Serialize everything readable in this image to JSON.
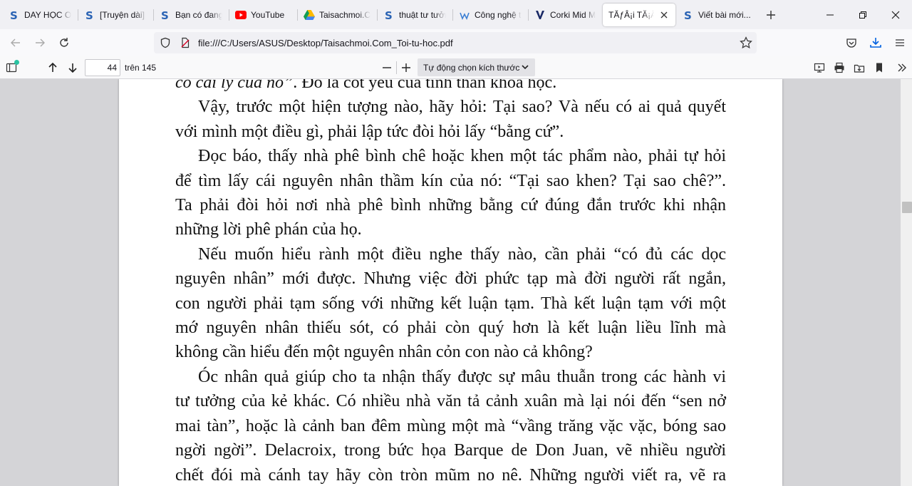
{
  "tabs": [
    {
      "title": "DAY HỌC ON",
      "icon": "s-icon",
      "fade": true
    },
    {
      "title": "[Truyện dài] N",
      "icon": "s-icon",
      "fade": true
    },
    {
      "title": "Bạn có đang",
      "icon": "s-icon",
      "fade": true
    },
    {
      "title": "YouTube",
      "icon": "youtube-icon",
      "fade": false
    },
    {
      "title": "Taisachmoi.C",
      "icon": "google-drive-icon",
      "fade": true
    },
    {
      "title": "thuật tư tưởn",
      "icon": "s-icon",
      "fade": true
    },
    {
      "title": "Công nghệ th",
      "icon": "wp-icon",
      "fade": true
    },
    {
      "title": "Corki Mid Mù",
      "icon": "v-icon",
      "fade": true
    },
    {
      "title": "TĂƒÂ¡i TĂ¡Â»Â",
      "icon": "none",
      "fade": true,
      "active": true
    },
    {
      "title": "Viết bài mới...",
      "icon": "s-icon",
      "fade": false
    }
  ],
  "navbar": {
    "url": "file:///C:/Users/ASUS/Desktop/Taisachmoi.Com_Toi-tu-hoc.pdf"
  },
  "pdf_toolbar": {
    "page_number": "44",
    "page_count": "trên 145",
    "zoom_label": "Tự động chọn kích thước"
  },
  "document": {
    "lines": [
      {
        "t": "có cái lý của nó”. Đó là cốt yếu của tinh thần khoa học.",
        "italic_prefix": "có cái lý của nó”",
        "indent": false,
        "last": true
      },
      {
        "t": "Vậy, trước một hiện tượng nào, hãy hỏi: Tại sao? Và nếu có ai quả quyết",
        "indent": true,
        "last": false
      },
      {
        "t": "với mình một điều gì, phải lập tức đòi hỏi lấy “bằng cứ”.",
        "indent": false,
        "last": true
      },
      {
        "t": "Đọc báo, thấy nhà phê bình chê hoặc khen một tác phẩm nào, phải tự hỏi",
        "indent": true,
        "last": false
      },
      {
        "t": "để tìm lấy cái nguyên nhân thầm kín của nó: “Tại sao khen? Tại sao chê?”.",
        "indent": false,
        "last": false
      },
      {
        "t": "Ta phải đòi hỏi nơi nhà phê bình những bằng cứ đúng đắn trước khi nhận",
        "indent": false,
        "last": false
      },
      {
        "t": "những lời phê phán của họ.",
        "indent": false,
        "last": true
      },
      {
        "t": "Nếu muốn hiểu rành một điều nghe thấy nào, cần phải “có đủ các dọc",
        "indent": true,
        "last": false
      },
      {
        "t": "nguyên nhân” mới được. Nhưng việc đời phức tạp mà đời người rất ngắn,",
        "indent": false,
        "last": false
      },
      {
        "t": "con người phải tạm sống với những kết luận tạm. Thà kết luận tạm với một",
        "indent": false,
        "last": false
      },
      {
        "t": "mớ nguyên nhân thiếu sót, có phải còn quý hơn là kết luận liều lĩnh mà",
        "indent": false,
        "last": false
      },
      {
        "t": "không cần hiểu đến một nguyên nhân cỏn con nào cả không?",
        "indent": false,
        "last": true
      },
      {
        "t": "Óc nhân quả giúp cho ta nhận thấy được sự mâu thuẫn trong các hành vi",
        "indent": true,
        "last": false
      },
      {
        "t": "tư tưởng của kẻ khác. Có nhiều nhà văn tả cảnh xuân mà lại nói đến “sen nở",
        "indent": false,
        "last": false
      },
      {
        "t": "mai tàn”, hoặc là cảnh ban đêm mùng một mà “vầng trăng vặc vặc, bóng sao",
        "indent": false,
        "last": false
      },
      {
        "t": "ngời ngời”. Delacroix, trong bức họa Barque de Don Juan, vẽ nhiều người",
        "indent": false,
        "last": false
      },
      {
        "t": "chết đói mà cánh tay hãy còn tròn mũm no nê. Những người viết ra, vẽ ra",
        "indent": false,
        "last": false
      }
    ]
  },
  "colors": {
    "tabbar_bg": "#f0f0f4",
    "youtube_red": "#ff0000",
    "s_icon_blue": "#2a63b4",
    "firefox_download_blue": "#0061e0",
    "sidebar_notification_green": "#2ac3a2"
  }
}
